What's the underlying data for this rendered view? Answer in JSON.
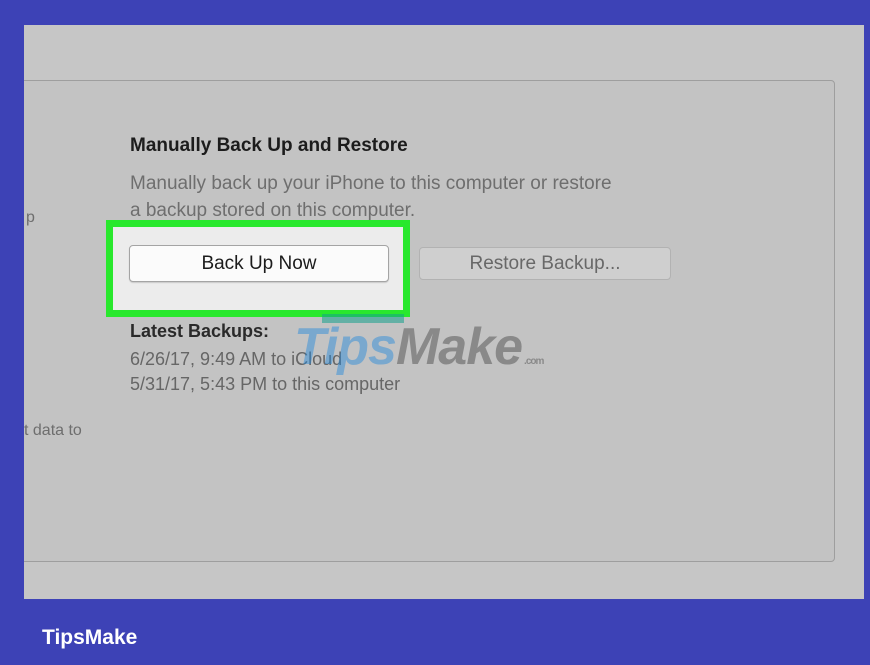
{
  "sidebar_fragments": [
    "p",
    "t data to"
  ],
  "section": {
    "title": "Manually Back Up and Restore",
    "description_line1": "Manually back up your iPhone to this computer or restore",
    "description_line2": "a backup stored on this computer."
  },
  "buttons": {
    "back_up_now": "Back Up Now",
    "restore_backup": "Restore Backup..."
  },
  "latest_backups": {
    "title": "Latest Backups:",
    "entries": [
      "6/26/17, 9:49 AM to iCloud",
      "5/31/17, 5:43 PM to this computer"
    ]
  },
  "watermark": {
    "part1": "Tips",
    "part2": "Make",
    "suffix": ".com"
  },
  "footer": {
    "brand": "TipsMake"
  },
  "colors": {
    "frame": "#3d42b6",
    "highlight": "#29e82d",
    "screen_bg": "#c6c6c6"
  }
}
